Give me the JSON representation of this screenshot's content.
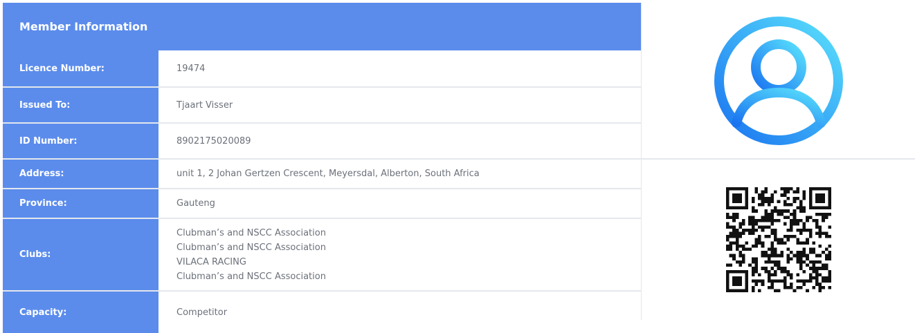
{
  "header": {
    "title": "Member Information"
  },
  "fields": [
    {
      "label": "Licence Number:",
      "value": "19474"
    },
    {
      "label": "Issued To:",
      "value": "Tjaart Visser"
    },
    {
      "label": "ID Number:",
      "value": "8902175020089"
    },
    {
      "label": "Address:",
      "value": "unit 1, 2 Johan Gertzen Crescent, Meyersdal, Alberton, South Africa"
    },
    {
      "label": "Province:",
      "value": "Gauteng"
    },
    {
      "label": "Clubs:",
      "values": [
        "Clubman’s and NSCC Association",
        "Clubman’s and NSCC Association",
        "VILACA RACING",
        "Clubman’s and NSCC Association"
      ]
    },
    {
      "label": "Capacity:",
      "value": "Competitor"
    }
  ],
  "avatar": {
    "icon": "user-avatar-icon",
    "gradient_start": "#1a74f0",
    "gradient_end": "#59e0fc"
  },
  "qr": {
    "icon": "qr-code-icon"
  },
  "colors": {
    "accent": "#5b8cec",
    "border": "#e4e7ec",
    "text": "#6b7079"
  }
}
